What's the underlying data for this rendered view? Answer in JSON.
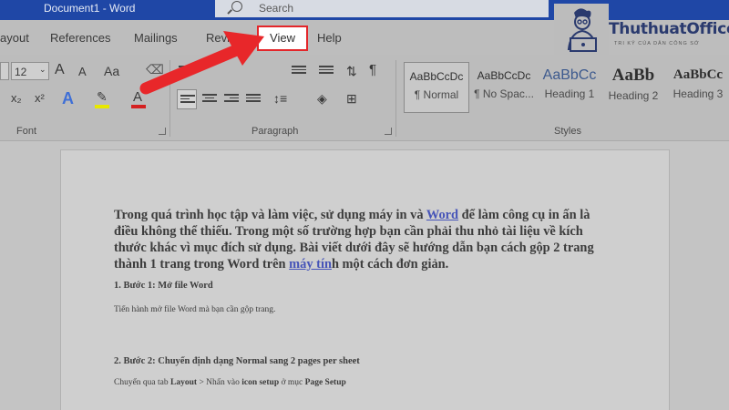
{
  "window": {
    "title": "Document1  -  Word"
  },
  "search": {
    "placeholder": "Search"
  },
  "tabs": [
    {
      "label": "ayout"
    },
    {
      "label": "References"
    },
    {
      "label": "Mailings"
    },
    {
      "label": "Review"
    },
    {
      "label": "View"
    },
    {
      "label": "Help"
    }
  ],
  "font_group": {
    "label": "Font",
    "size_value": "12",
    "grow_label": "A",
    "shrink_label": "A",
    "case_label": "Aa",
    "subscript_label": "x₂",
    "superscript_label": "x²",
    "effects_label": "A",
    "highlight_color": "#e8e800",
    "font_color": "#d42020"
  },
  "paragraph_group": {
    "label": "Paragraph",
    "pilcrow": "¶"
  },
  "styles_group": {
    "label": "Styles",
    "items": [
      {
        "sample": "AaBbCcDc",
        "name": "¶ Normal"
      },
      {
        "sample": "AaBbCcDc",
        "name": "¶ No Spac..."
      },
      {
        "sample": "AaBbCc",
        "name": "Heading 1"
      },
      {
        "sample": "AaBb",
        "name": "Heading 2"
      },
      {
        "sample": "AaBbCc",
        "name": "Heading 3"
      }
    ]
  },
  "logo": {
    "brand": "ThuthuatOffice",
    "tagline": "TRI KỶ CỦA DÂN CÔNG SỞ"
  },
  "document": {
    "para_part1": "Trong quá trình học tập và làm việc, sử dụng máy in và ",
    "link_word": "Word",
    "para_part2": " để làm công cụ in ấn là điều không thể thiếu. Trong một số trường hợp bạn cần phải thu nhỏ tài liệu về kích thước khác vì mục đích sử dụng. Bài viết dưới đây sẽ hướng dẫn bạn cách gộp 2 trang thành 1 trang trong Word trên ",
    "link_maytinh": "máy tín",
    "para_part3": "h một cách đơn giản.",
    "step1_heading": "1. Bước 1: Mở file Word",
    "step1_text": "Tiến hành mở file Word mà bạn cần gộp trang.",
    "step2_heading": "2. Bước 2: Chuyển định dạng Normal sang 2 pages per sheet",
    "step2_text_a": "Chuyển qua tab ",
    "step2_text_b": "Layout",
    "step2_text_c": " > Nhấn vào ",
    "step2_text_d": "icon setup",
    "step2_text_e": " ở mục ",
    "step2_text_f": "Page Setup"
  },
  "annotation": {
    "arrow_color": "#e8272a"
  }
}
